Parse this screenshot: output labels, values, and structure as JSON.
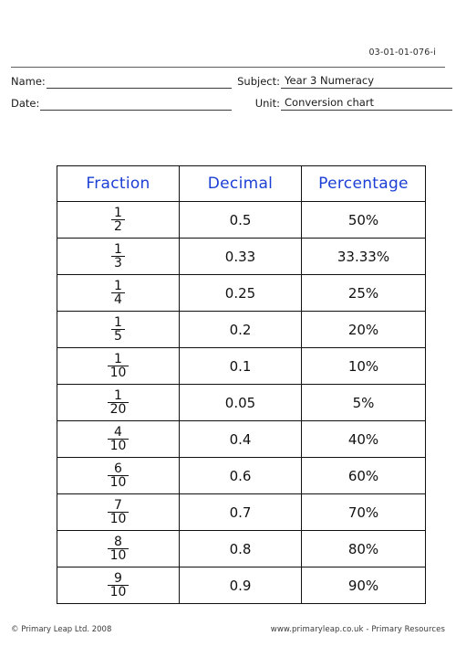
{
  "document": {
    "code": "03-01-01-076-i"
  },
  "identity": {
    "name_label": "Name:",
    "name_value": "",
    "date_label": "Date:",
    "date_value": "",
    "subject_label": "Subject:",
    "subject_value": "Year 3 Numeracy",
    "unit_label": "Unit:",
    "unit_value": "Conversion chart"
  },
  "colors": {
    "header_blue": "#1b3fd4",
    "ink": "#111111",
    "page": "#ffffff"
  },
  "table": {
    "headers": [
      "Fraction",
      "Decimal",
      "Percentage"
    ],
    "rows": [
      {
        "numerator": "1",
        "denominator": "2",
        "decimal": "0.5",
        "percentage": "50%"
      },
      {
        "numerator": "1",
        "denominator": "3",
        "decimal": "0.33",
        "percentage": "33.33%"
      },
      {
        "numerator": "1",
        "denominator": "4",
        "decimal": "0.25",
        "percentage": "25%"
      },
      {
        "numerator": "1",
        "denominator": "5",
        "decimal": "0.2",
        "percentage": "20%"
      },
      {
        "numerator": "1",
        "denominator": "10",
        "decimal": "0.1",
        "percentage": "10%"
      },
      {
        "numerator": "1",
        "denominator": "20",
        "decimal": "0.05",
        "percentage": "5%"
      },
      {
        "numerator": "4",
        "denominator": "10",
        "decimal": "0.4",
        "percentage": "40%"
      },
      {
        "numerator": "6",
        "denominator": "10",
        "decimal": "0.6",
        "percentage": "60%"
      },
      {
        "numerator": "7",
        "denominator": "10",
        "decimal": "0.7",
        "percentage": "70%"
      },
      {
        "numerator": "8",
        "denominator": "10",
        "decimal": "0.8",
        "percentage": "80%"
      },
      {
        "numerator": "9",
        "denominator": "10",
        "decimal": "0.9",
        "percentage": "90%"
      }
    ]
  },
  "footer": {
    "copyright": "© Primary Leap Ltd. 2008",
    "site": "www.primaryleap.co.uk  -  Primary Resources"
  }
}
